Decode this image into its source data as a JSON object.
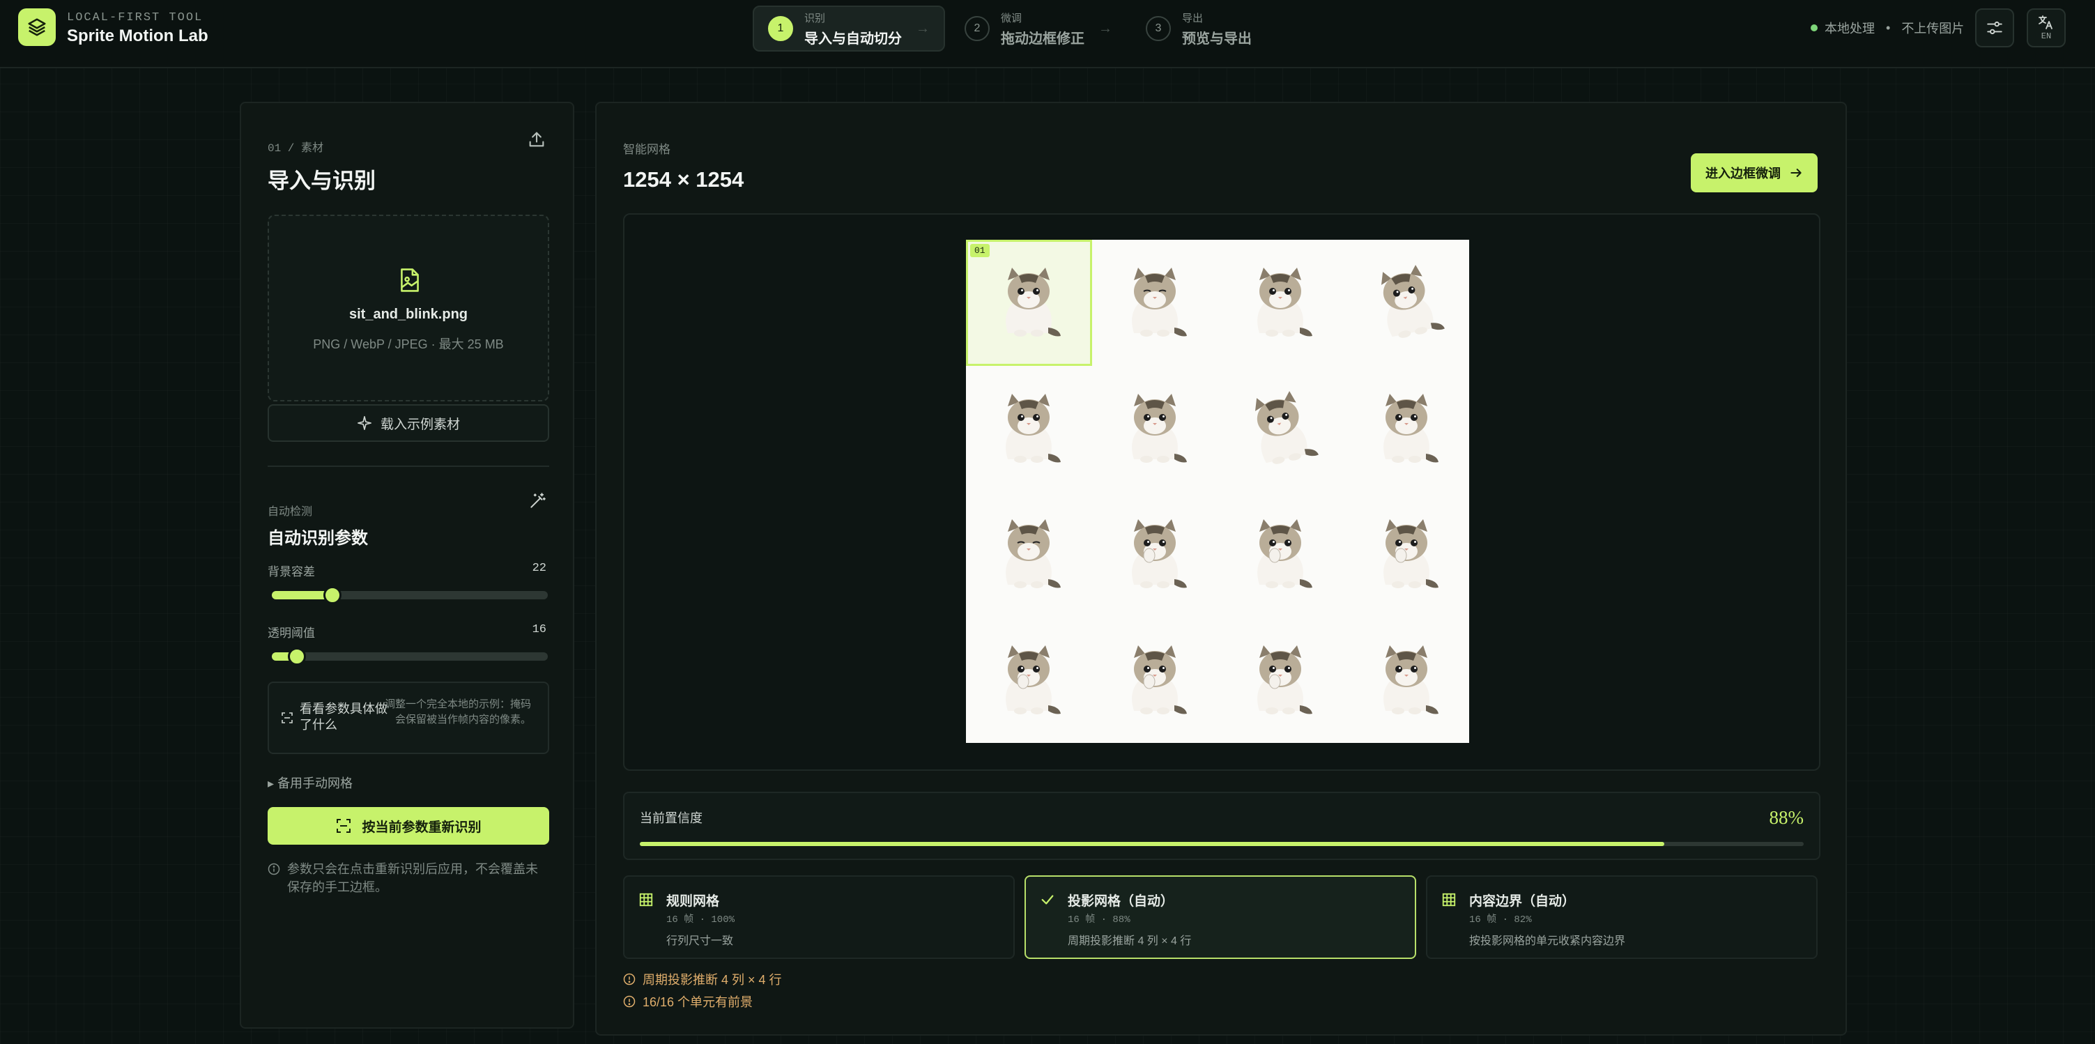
{
  "brand": {
    "subtitle": "LOCAL-FIRST TOOL",
    "title": "Sprite Motion Lab"
  },
  "steps": [
    {
      "num": "1",
      "small": "识别",
      "label": "导入与自动切分",
      "active": true
    },
    {
      "num": "2",
      "small": "微调",
      "label": "拖动边框修正",
      "active": false
    },
    {
      "num": "3",
      "small": "导出",
      "label": "预览与导出",
      "active": false
    }
  ],
  "status": {
    "local": "本地处理",
    "no_upload": "不上传图片"
  },
  "lang_button": {
    "label": "EN"
  },
  "left": {
    "crumb": "01 / 素材",
    "title": "导入与识别",
    "file": {
      "name": "sit_and_blink.png",
      "hint": "PNG / WebP / JPEG · 最大 25 MB"
    },
    "sample_button": "载入示例素材",
    "auto_label": "自动检测",
    "params_title": "自动识别参数",
    "sliders": [
      {
        "label": "背景容差",
        "value": "22",
        "fraction": 0.22
      },
      {
        "label": "透明阈值",
        "value": "16",
        "fraction": 0.09
      }
    ],
    "explain": {
      "title": "看看参数具体做了什么",
      "desc": "调整一个完全本地的示例：掩码会保留被当作帧内容的像素。"
    },
    "manual_toggle": "备用手动网格",
    "rerun_button": "按当前参数重新识别",
    "note": "参数只会在点击重新识别后应用，不会覆盖未保存的手工边框。"
  },
  "main": {
    "grid_label": "智能网格",
    "grid_size": "1254 × 1254",
    "enter_button": "进入边框微调",
    "selected_cell_tag": "01",
    "cells": [
      "cat",
      "cat-squint",
      "cat",
      "cat-tilt",
      "cat",
      "cat",
      "cat-tilt",
      "cat",
      "cat-squint",
      "cat-paw",
      "cat-paw",
      "cat-paw",
      "cat-paw",
      "cat-paw",
      "cat-paw",
      "cat"
    ],
    "confidence": {
      "label": "当前置信度",
      "value": "88%",
      "fraction": 0.88
    },
    "methods": [
      {
        "title": "规则网格",
        "meta": "16 帧 · 100%",
        "desc": "行列尺寸一致",
        "icon": "grid-icon",
        "selected": false
      },
      {
        "title": "投影网格（自动）",
        "meta": "16 帧 · 88%",
        "desc": "周期投影推断 4 列 × 4 行",
        "icon": "check-icon",
        "selected": true
      },
      {
        "title": "内容边界（自动）",
        "meta": "16 帧 · 82%",
        "desc": "按投影网格的单元收紧内容边界",
        "icon": "grid-icon",
        "selected": false
      }
    ],
    "warnings": [
      "周期投影推断 4 列 × 4 行",
      "16/16 个单元有前景"
    ]
  },
  "colors": {
    "accent": "#c7f26b",
    "background": "#0b1311",
    "panel": "#0f1714",
    "warning": "#e0ae6c"
  }
}
